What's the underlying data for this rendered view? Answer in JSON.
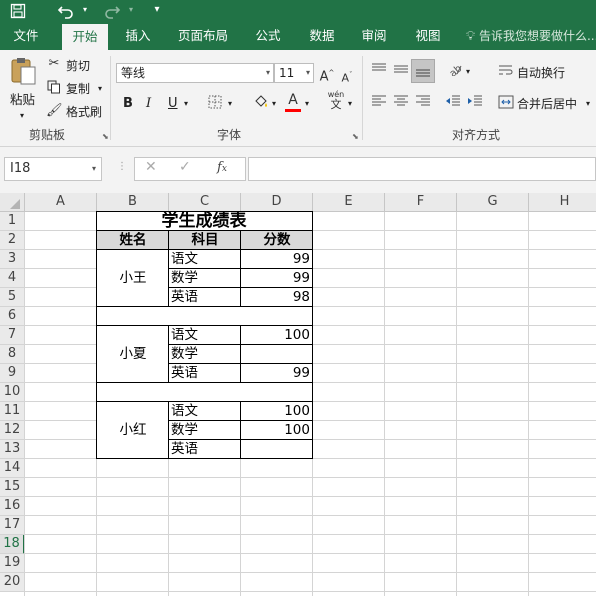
{
  "quick_access": {
    "save_icon": "save-icon",
    "undo_icon": "undo-icon",
    "redo_icon": "redo-icon",
    "customize_icon": "customize-qat-icon"
  },
  "tabs": [
    {
      "label": "文件"
    },
    {
      "label": "开始",
      "active": true
    },
    {
      "label": "插入"
    },
    {
      "label": "页面布局"
    },
    {
      "label": "公式"
    },
    {
      "label": "数据"
    },
    {
      "label": "审阅"
    },
    {
      "label": "视图"
    }
  ],
  "tell_me": "告诉我您想要做什么...",
  "ribbon": {
    "clipboard": {
      "paste": "粘贴",
      "cut": "剪切",
      "copy": "复制",
      "format_painter": "格式刷",
      "group_label": "剪贴板"
    },
    "font": {
      "font_name": "等线",
      "font_size": "11",
      "bold": "B",
      "italic": "I",
      "underline": "U",
      "font_color_letter": "A",
      "wen": "wén",
      "wen_char": "文",
      "group_label": "字体"
    },
    "alignment": {
      "wrap_text": "自动换行",
      "merge_center": "合并后居中",
      "group_label": "对齐方式"
    }
  },
  "formula_bar": {
    "name_box": "I18",
    "formula": ""
  },
  "columns": [
    "A",
    "B",
    "C",
    "D",
    "E",
    "F",
    "G",
    "H"
  ],
  "rows": [
    "1",
    "2",
    "3",
    "4",
    "5",
    "6",
    "7",
    "8",
    "9",
    "10",
    "11",
    "12",
    "13",
    "14",
    "15",
    "16",
    "17",
    "18",
    "19",
    "20"
  ],
  "selected_row": "18",
  "sheet": {
    "title": "学生成绩表",
    "headers": {
      "name": "姓名",
      "subject": "科目",
      "score": "分数"
    },
    "students": [
      {
        "name": "小王",
        "rows": [
          {
            "subject": "语文",
            "score": "99"
          },
          {
            "subject": "数学",
            "score": "99"
          },
          {
            "subject": "英语",
            "score": "98"
          }
        ]
      },
      {
        "name": "小夏",
        "rows": [
          {
            "subject": "语文",
            "score": "100"
          },
          {
            "subject": "数学",
            "score": ""
          },
          {
            "subject": "英语",
            "score": "99"
          }
        ]
      },
      {
        "name": "小红",
        "rows": [
          {
            "subject": "语文",
            "score": "100"
          },
          {
            "subject": "数学",
            "score": "100"
          },
          {
            "subject": "英语",
            "score": ""
          }
        ]
      }
    ]
  },
  "colors": {
    "accent": "#217346",
    "font_color_bar": "#ff0000",
    "header_fill": "#d9d9d9"
  }
}
